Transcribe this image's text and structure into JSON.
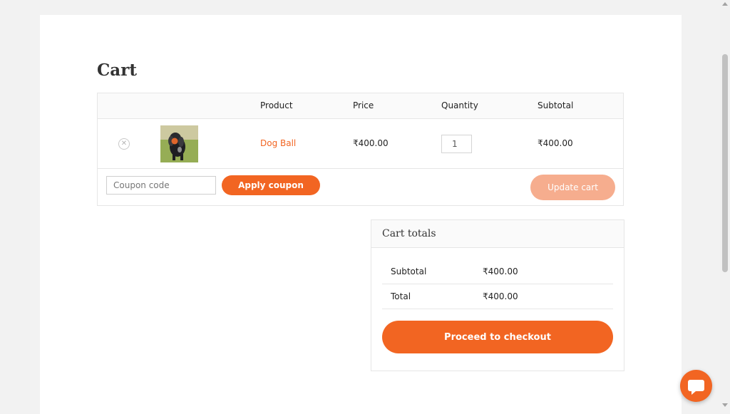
{
  "page": {
    "title": "Cart"
  },
  "cart_table": {
    "headers": {
      "product": "Product",
      "price": "Price",
      "quantity": "Quantity",
      "subtotal": "Subtotal"
    },
    "items": [
      {
        "name": "Dog Ball",
        "price": "₹400.00",
        "quantity": "1",
        "subtotal": "₹400.00",
        "remove_icon": "close-circle-icon",
        "thumbnail": "dog-with-ball-photo"
      }
    ],
    "coupon": {
      "placeholder": "Coupon code",
      "apply_label": "Apply coupon"
    },
    "update_label": "Update cart"
  },
  "cart_totals": {
    "title": "Cart totals",
    "rows": [
      {
        "label": "Subtotal",
        "value": "₹400.00"
      },
      {
        "label": "Total",
        "value": "₹400.00"
      }
    ],
    "checkout_label": "Proceed to checkout"
  },
  "colors": {
    "accent": "#f26522",
    "accent_disabled": "#f6ad8e",
    "border": "#e6e6e6"
  },
  "widgets": {
    "chat_icon": "chat-bubble-icon"
  }
}
